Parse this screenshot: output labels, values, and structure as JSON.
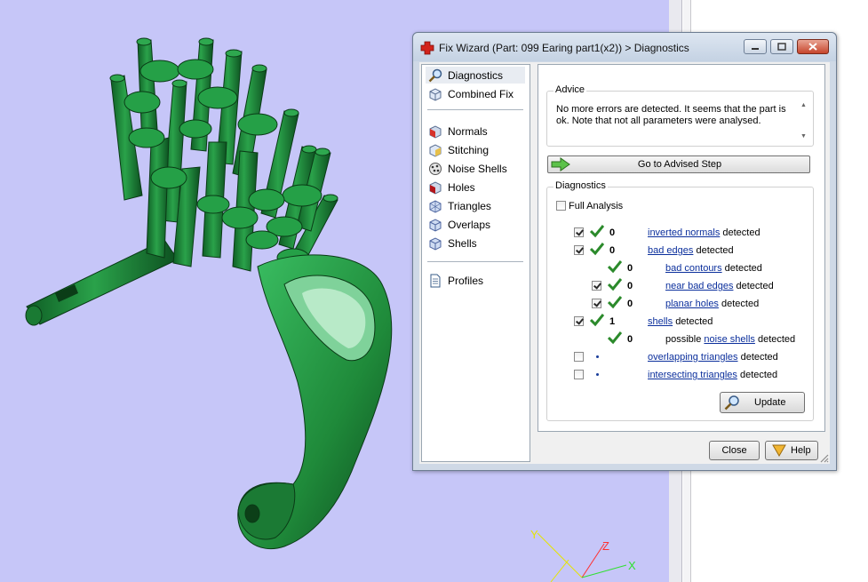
{
  "window": {
    "title": "Fix Wizard (Part: 099 Earing part1(x2)) > Diagnostics"
  },
  "nav": {
    "items": [
      {
        "label": "Diagnostics",
        "icon": "magnifier-icon",
        "selected": true
      },
      {
        "label": "Combined Fix",
        "icon": "cube-icon"
      },
      {
        "label": "Normals",
        "icon": "normals-cube-icon"
      },
      {
        "label": "Stitching",
        "icon": "stitching-cube-icon"
      },
      {
        "label": "Noise Shells",
        "icon": "noise-shells-icon"
      },
      {
        "label": "Holes",
        "icon": "holes-cube-icon"
      },
      {
        "label": "Triangles",
        "icon": "triangles-cube-icon"
      },
      {
        "label": "Overlaps",
        "icon": "overlaps-cube-icon"
      },
      {
        "label": "Shells",
        "icon": "shells-cube-icon"
      },
      {
        "label": "Profiles",
        "icon": "document-icon"
      }
    ]
  },
  "advice": {
    "label": "Advice",
    "text": "No more errors are detected. It seems that the part is ok. Note that not all parameters were analysed."
  },
  "advised_step_label": "Go to Advised Step",
  "diagnostics": {
    "label": "Diagnostics",
    "full_analysis_label": "Full Analysis",
    "detected_word": "detected",
    "rows": [
      {
        "count": "0",
        "link": "inverted normals",
        "prefix": "",
        "checked": true
      },
      {
        "count": "0",
        "link": "bad edges",
        "prefix": "",
        "checked": true
      },
      {
        "count": "0",
        "link": "bad contours",
        "prefix": ""
      },
      {
        "count": "0",
        "link": "near bad edges",
        "prefix": "",
        "checked": true
      },
      {
        "count": "0",
        "link": "planar holes",
        "prefix": "",
        "checked": true
      },
      {
        "count": "1",
        "link": "shells",
        "prefix": "",
        "checked": true
      },
      {
        "count": "0",
        "link": "noise shells",
        "prefix": "possible "
      },
      {
        "count": "",
        "link": "overlapping triangles",
        "prefix": "",
        "checked": false
      },
      {
        "count": "",
        "link": "intersecting triangles",
        "prefix": "",
        "checked": false
      }
    ],
    "update_label": "Update"
  },
  "buttons": {
    "close": "Close",
    "help": "Help"
  },
  "axes": {
    "x": "X",
    "y": "Y",
    "z": "Z"
  },
  "colors": {
    "viewport_bg": "#c6c6f8",
    "model_green": "#1f8a3a",
    "link_blue": "#0b2f9c",
    "check_green": "#2b8a2b"
  }
}
